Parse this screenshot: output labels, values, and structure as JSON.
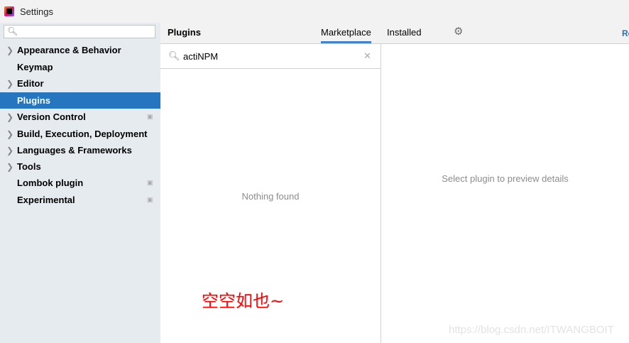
{
  "window": {
    "title": "Settings"
  },
  "sidebar": {
    "search_placeholder": "",
    "items": [
      {
        "label": "Appearance & Behavior",
        "expandable": true
      },
      {
        "label": "Keymap",
        "expandable": false
      },
      {
        "label": "Editor",
        "expandable": true
      },
      {
        "label": "Plugins",
        "expandable": false,
        "selected": true
      },
      {
        "label": "Version Control",
        "expandable": true,
        "project": true
      },
      {
        "label": "Build, Execution, Deployment",
        "expandable": true
      },
      {
        "label": "Languages & Frameworks",
        "expandable": true
      },
      {
        "label": "Tools",
        "expandable": true
      },
      {
        "label": "Lombok plugin",
        "expandable": false,
        "project": true
      },
      {
        "label": "Experimental",
        "expandable": false,
        "project": true
      }
    ]
  },
  "header": {
    "title": "Plugins",
    "tabs": [
      {
        "label": "Marketplace",
        "active": true
      },
      {
        "label": "Installed",
        "active": false
      }
    ],
    "right_link": "Re"
  },
  "plugin_search": {
    "value": "actiNPM"
  },
  "list": {
    "empty_text": "Nothing found",
    "annotation": "空空如也~"
  },
  "preview": {
    "text": "Select plugin to preview details"
  },
  "watermark": "https://blog.csdn.net/ITWANGBOIT"
}
